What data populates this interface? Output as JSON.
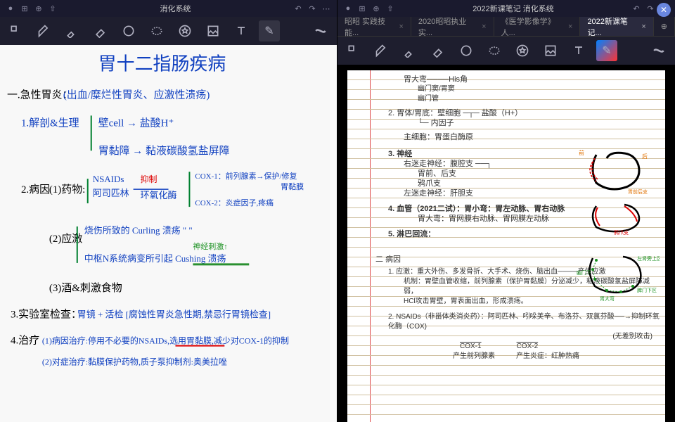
{
  "left": {
    "title": "消化系统",
    "bullet": "●",
    "handwriting": {
      "main_title": "胃十二指肠疾病",
      "section1": "一.急性胃炎：",
      "section1_sub": "(出血/糜烂性胃炎、应激性溃疡)",
      "s1_1": "1.解剖&生理",
      "s1_1a": "壁cell → 盐酸H⁺",
      "s1_1b": "胃黏障 → 黏液碳酸氢盐屏障",
      "s2": "2.病因",
      "s2_1": "(1)药物:",
      "s2_1a": "NSAIDs",
      "s2_1b": "阿司匹林",
      "s2_1c": "抑制",
      "s2_1d": "环氧化酶",
      "s2_1e": "COX-1：前列腺素→保护/修复",
      "s2_1f": "胃黏膜",
      "s2_1g": "COX-2：炎症因子,疼痛",
      "s2_2": "(2)应激",
      "s2_2a": "烧伤所致的 Curling 溃疡  \" \"",
      "s2_2b": "中枢N系统病变所引起 Cushing 溃疡",
      "s2_2c": "神经刺激↑",
      "s2_3": "(3)酒&刺激食物",
      "s3": "3.实验室检查：",
      "s3a": "胃镜 + 活检 [腐蚀性胃炎急性期,禁忌行胃镜检查]",
      "s4": "4.治疗",
      "s4a": "(1)病因治疗:停用不必要的NSAIDs,选用胃黏膜,减少对COX-1的抑制",
      "s4b": "(2)对症治疗:黏膜保护药物,质子泵抑制剂:奥美拉唑"
    }
  },
  "right": {
    "title": "2022新课笔记 消化系统",
    "close_x": "✕",
    "tabs": [
      {
        "label": "昭昭 实践技能...",
        "active": false
      },
      {
        "label": "2020昭昭执业 实...",
        "active": false
      },
      {
        "label": "《医学影像学》人...",
        "active": false
      },
      {
        "label": "2022新课笔记...",
        "active": true
      }
    ],
    "notes": {
      "l1": "胃大弯────His角",
      "l2": "幽门窦/胃窦",
      "l3": "幽门管",
      "l4": "2. 胃体/胃底：壁细胞",
      "l4a": "盐酸（H+）",
      "l4b": "内因子",
      "l5": "主细胞：胃蛋白酶原",
      "l6": "3. 神经",
      "l6a": "右迷走神经：腹腔支",
      "l6b": "胃前、后支",
      "l6c": "鸦爪支",
      "l6d": "左迷走神经：肝胆支",
      "l7": "4. 血管（2021二试）：胃小弯：胃左动脉、胃右动脉",
      "l7a": "胃大弯：胃网膜右动脉、胃网膜左动脉",
      "l8": "5. 淋巴回流：",
      "sec2": "二 病因",
      "s2_1": "1. 应激：重大外伤、多发骨折、大手术、烧伤、脑出血────产生应激",
      "s2_1a": "机制：胃壁血管收缩，前列腺素（保护胃黏膜）分泌减少，粘液碳酸氢盐屏障减弱，",
      "s2_1b": "HCl攻击胃壁，胃表面出血，形成溃疡。",
      "s2_2": "2. NSAIDs（非甾体类消炎药）：阿司匹林、吲哚美辛、布洛芬、双氯芬酸──→抑制环氧化酶（COX)",
      "s2_2a": "COX-1",
      "s2_2b": "COX-2",
      "s2_2c": "(无差别攻击)",
      "s2_2d": "产生前列腺素",
      "s2_2e": "产生炎症：红肿热痛",
      "annot1": "前",
      "annot2": "后",
      "annot3": "胃前后支",
      "annot4": "鸦爪支",
      "annot5": "幽门下",
      "annot6": "胃大弯",
      "annot7": "胃小弯",
      "annot8": "左肾旁上区",
      "annot9": "脾门下区"
    }
  }
}
